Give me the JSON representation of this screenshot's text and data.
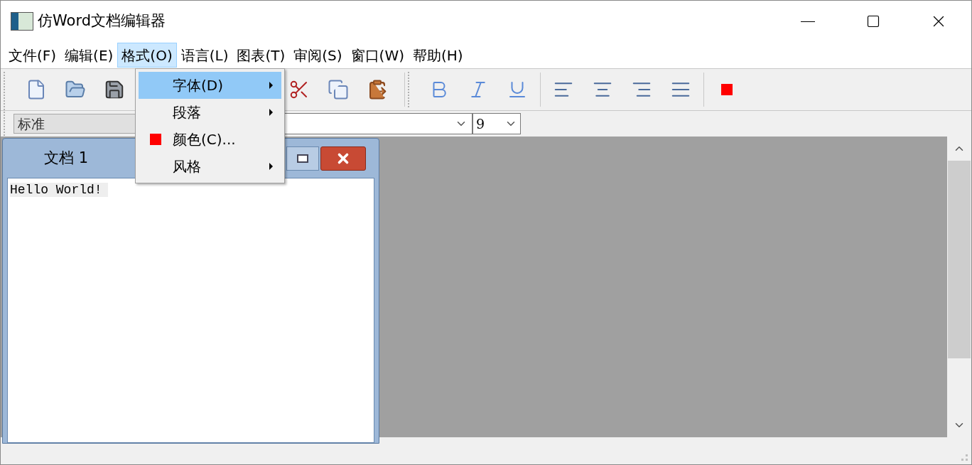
{
  "window": {
    "title": "仿Word文档编辑器"
  },
  "menu_bar": [
    {
      "label": "文件(F)",
      "selected": false
    },
    {
      "label": "编辑(E)",
      "selected": false
    },
    {
      "label": "格式(O)",
      "selected": true
    },
    {
      "label": "语言(L)",
      "selected": false
    },
    {
      "label": "图表(T)",
      "selected": false
    },
    {
      "label": "审阅(S)",
      "selected": false
    },
    {
      "label": "窗口(W)",
      "selected": false
    },
    {
      "label": "帮助(H)",
      "selected": false
    }
  ],
  "format_menu": {
    "items": [
      {
        "label": "字体(D)",
        "selected": true,
        "kind": "submenu"
      },
      {
        "label": "段落",
        "selected": false,
        "kind": "submenu"
      },
      {
        "label": "颜色(C)...",
        "selected": false,
        "kind": "color"
      },
      {
        "label": "风格",
        "selected": false,
        "kind": "submenu"
      }
    ]
  },
  "format_bar": {
    "style": "标准",
    "size": "9"
  },
  "document": {
    "title": "文档 1",
    "text": "Hello World!"
  }
}
